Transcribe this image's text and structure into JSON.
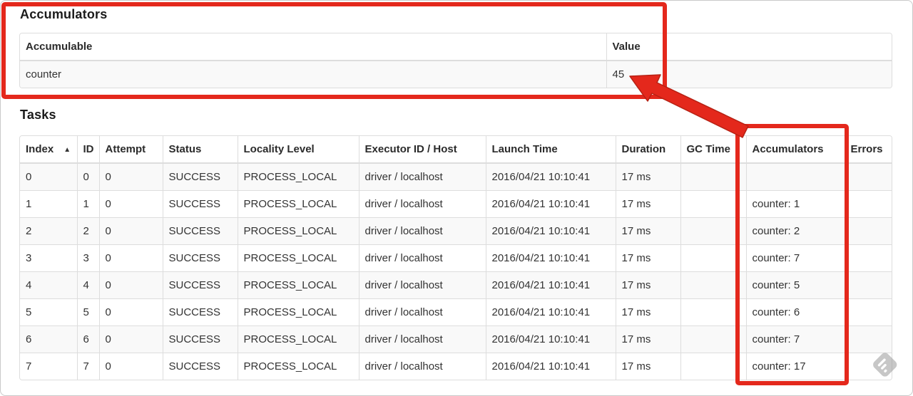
{
  "accumulators_section": {
    "title": "Accumulators",
    "table": {
      "headers": [
        "Accumulable",
        "Value"
      ],
      "rows": [
        {
          "accumulable": "counter",
          "value": "45"
        }
      ]
    }
  },
  "tasks_section": {
    "title": "Tasks",
    "table": {
      "headers": [
        "Index",
        "ID",
        "Attempt",
        "Status",
        "Locality Level",
        "Executor ID / Host",
        "Launch Time",
        "Duration",
        "GC Time",
        "Accumulators",
        "Errors"
      ],
      "sort_icon": "▲",
      "rows": [
        {
          "index": "0",
          "id": "0",
          "attempt": "0",
          "status": "SUCCESS",
          "locality": "PROCESS_LOCAL",
          "executor": "driver / localhost",
          "launch": "2016/04/21 10:10:41",
          "duration": "17 ms",
          "gc_time": "",
          "accumulators": "",
          "errors": ""
        },
        {
          "index": "1",
          "id": "1",
          "attempt": "0",
          "status": "SUCCESS",
          "locality": "PROCESS_LOCAL",
          "executor": "driver / localhost",
          "launch": "2016/04/21 10:10:41",
          "duration": "17 ms",
          "gc_time": "",
          "accumulators": "counter: 1",
          "errors": ""
        },
        {
          "index": "2",
          "id": "2",
          "attempt": "0",
          "status": "SUCCESS",
          "locality": "PROCESS_LOCAL",
          "executor": "driver / localhost",
          "launch": "2016/04/21 10:10:41",
          "duration": "17 ms",
          "gc_time": "",
          "accumulators": "counter: 2",
          "errors": ""
        },
        {
          "index": "3",
          "id": "3",
          "attempt": "0",
          "status": "SUCCESS",
          "locality": "PROCESS_LOCAL",
          "executor": "driver / localhost",
          "launch": "2016/04/21 10:10:41",
          "duration": "17 ms",
          "gc_time": "",
          "accumulators": "counter: 7",
          "errors": ""
        },
        {
          "index": "4",
          "id": "4",
          "attempt": "0",
          "status": "SUCCESS",
          "locality": "PROCESS_LOCAL",
          "executor": "driver / localhost",
          "launch": "2016/04/21 10:10:41",
          "duration": "17 ms",
          "gc_time": "",
          "accumulators": "counter: 5",
          "errors": ""
        },
        {
          "index": "5",
          "id": "5",
          "attempt": "0",
          "status": "SUCCESS",
          "locality": "PROCESS_LOCAL",
          "executor": "driver / localhost",
          "launch": "2016/04/21 10:10:41",
          "duration": "17 ms",
          "gc_time": "",
          "accumulators": "counter: 6",
          "errors": ""
        },
        {
          "index": "6",
          "id": "6",
          "attempt": "0",
          "status": "SUCCESS",
          "locality": "PROCESS_LOCAL",
          "executor": "driver / localhost",
          "launch": "2016/04/21 10:10:41",
          "duration": "17 ms",
          "gc_time": "",
          "accumulators": "counter: 7",
          "errors": ""
        },
        {
          "index": "7",
          "id": "7",
          "attempt": "0",
          "status": "SUCCESS",
          "locality": "PROCESS_LOCAL",
          "executor": "driver / localhost",
          "launch": "2016/04/21 10:10:41",
          "duration": "17 ms",
          "gc_time": "",
          "accumulators": "counter: 17",
          "errors": ""
        }
      ]
    }
  },
  "annotations": {
    "box_color": "#e4281c",
    "arrow_outline": "#b62114"
  },
  "colors": {
    "table_border": "#dddddd",
    "stripe_bg": "#f9f9f9",
    "text": "#333333",
    "watermark_gray": "#9a9a9a"
  }
}
